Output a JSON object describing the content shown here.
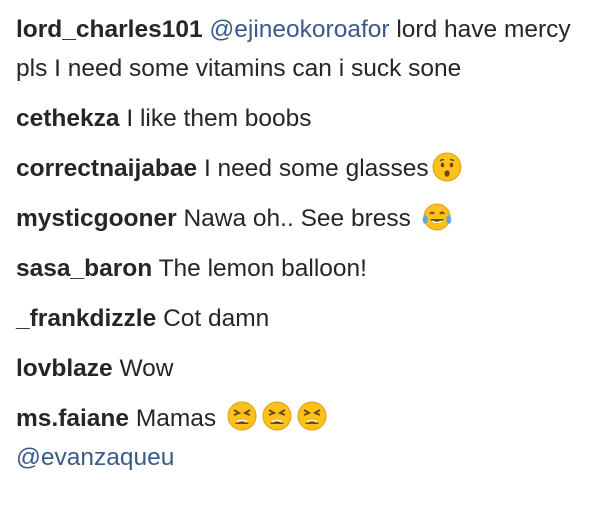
{
  "comments": [
    {
      "user": "lord_charles101",
      "mention": "@ejineokoroafor",
      "text": "lord have mercy pls I need some vitamins can i suck sone"
    },
    {
      "user": "cethekza",
      "text": "I like them boobs"
    },
    {
      "user": "correctnaijabae",
      "text": "I need some glasses",
      "emoji": [
        "hushed-face-icon"
      ]
    },
    {
      "user": "mysticgooner",
      "text": "Nawa oh.. See bress",
      "emoji": [
        "tears-of-joy-icon"
      ]
    },
    {
      "user": "sasa_baron",
      "text": "The lemon balloon!"
    },
    {
      "user": "_frankdizzle",
      "text": "Cot damn"
    },
    {
      "user": "lovblaze",
      "text": "Wow"
    },
    {
      "user": "ms.faiane",
      "text": "Mamas",
      "emoji": [
        "tired-face-icon",
        "tired-face-icon",
        "tired-face-icon"
      ],
      "mention_after": "@evanzaqueu"
    }
  ],
  "colors": {
    "username": "#262626",
    "mention": "#3a5a8a",
    "emoji_face": "#fcc21b"
  }
}
